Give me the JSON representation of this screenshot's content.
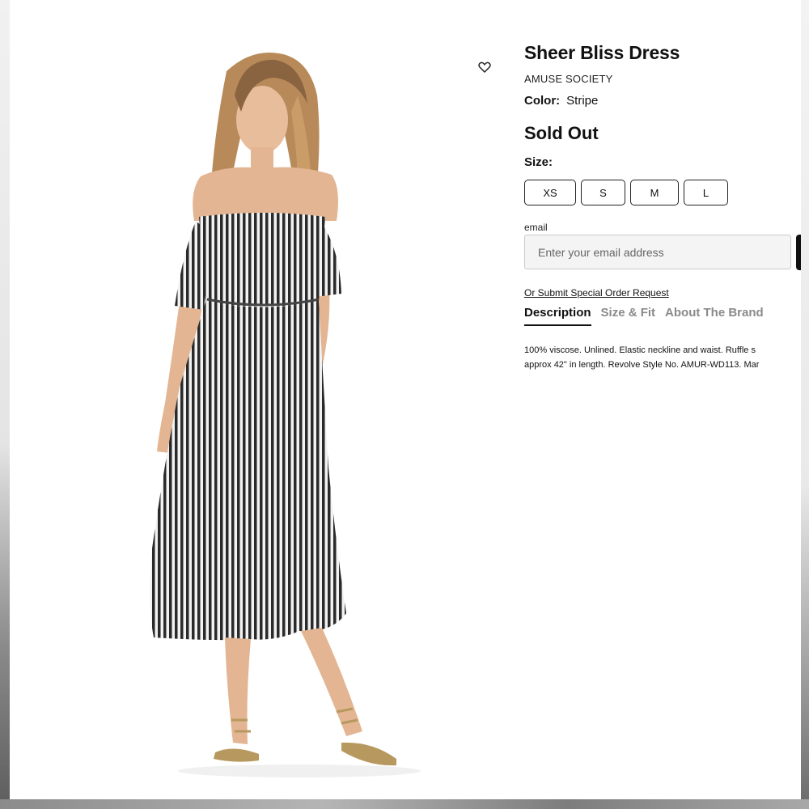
{
  "product": {
    "title": "Sheer Bliss Dress",
    "brand": "AMUSE SOCIETY",
    "color_label": "Color:",
    "color_value": "Stripe",
    "status": "Sold Out",
    "size_label": "Size:",
    "sizes": [
      "XS",
      "S",
      "M",
      "L"
    ],
    "wishlist_icon": "heart-outline-icon"
  },
  "email": {
    "label": "email",
    "placeholder": "Enter your email address"
  },
  "special_order_link": "Or Submit Special Order Request",
  "tabs": [
    "Description",
    "Size & Fit",
    "About The Brand"
  ],
  "active_tab": "Description",
  "description": {
    "line1": "100% viscose. Unlined. Elastic neckline and waist. Ruffle s",
    "line2": "approx 42\" in length. Revolve Style No. AMUR-WD113. Mar"
  },
  "colors": {
    "text": "#111111",
    "muted_tab": "#8a8a8a",
    "input_bg": "#f4f4f4",
    "page_bg": "#ffffff"
  }
}
